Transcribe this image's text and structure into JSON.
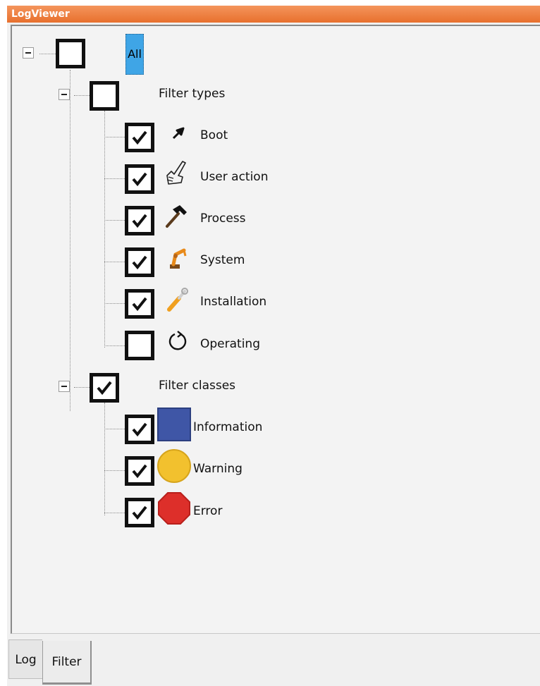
{
  "window": {
    "title": "LogViewer"
  },
  "tree": {
    "root": {
      "label": "All",
      "checked": false,
      "selected": true
    },
    "types": {
      "label": "Filter types",
      "checked": false,
      "items": [
        {
          "label": "Boot",
          "checked": true,
          "icon": "arrow-up-right-icon"
        },
        {
          "label": "User action",
          "checked": true,
          "icon": "pointing-hand-icon"
        },
        {
          "label": "Process",
          "checked": true,
          "icon": "hammer-icon"
        },
        {
          "label": "System",
          "checked": true,
          "icon": "robot-icon"
        },
        {
          "label": "Installation",
          "checked": true,
          "icon": "wrench-screwdriver-icon"
        },
        {
          "label": "Operating",
          "checked": false,
          "icon": "circular-arrow-icon"
        }
      ]
    },
    "classes": {
      "label": "Filter classes",
      "checked": true,
      "items": [
        {
          "label": "Information",
          "checked": true,
          "icon": "blue-square-icon",
          "color": "#3f56a6"
        },
        {
          "label": "Warning",
          "checked": true,
          "icon": "yellow-circle-icon",
          "color": "#f2c12e"
        },
        {
          "label": "Error",
          "checked": true,
          "icon": "red-octagon-icon",
          "color": "#dd2f2a"
        }
      ]
    }
  },
  "tabs": [
    {
      "label": "Log",
      "active": false
    },
    {
      "label": "Filter",
      "active": true
    }
  ]
}
